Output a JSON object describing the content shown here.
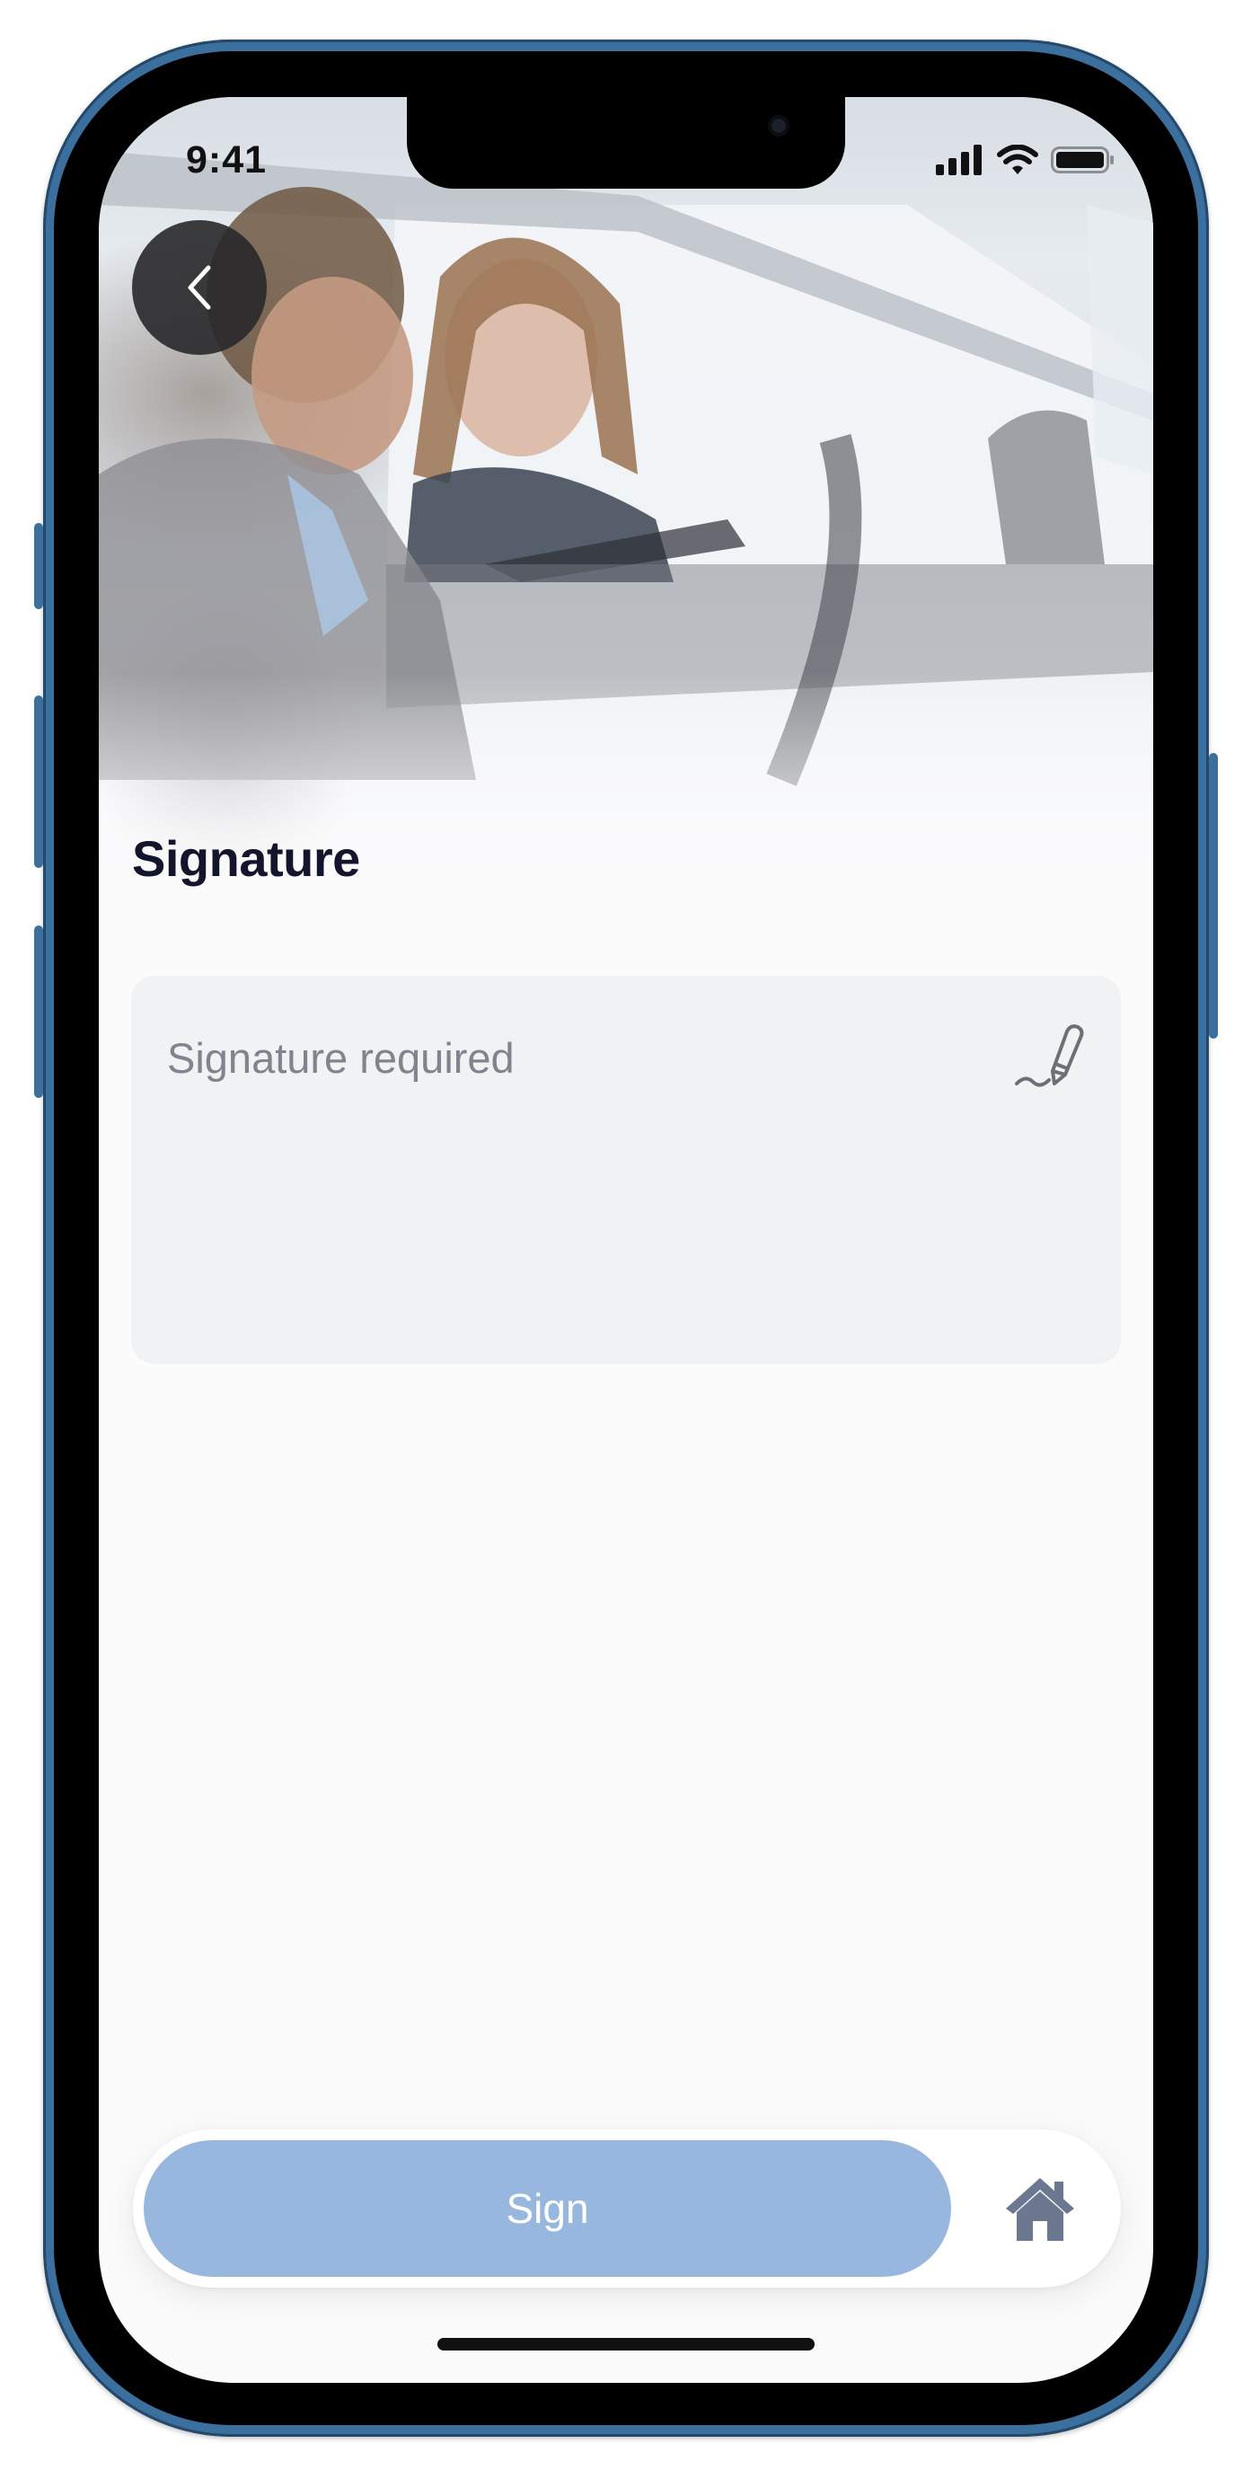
{
  "status_bar": {
    "time": "9:41"
  },
  "header": {
    "back_icon": "chevron-left-icon"
  },
  "page": {
    "title": "Signature"
  },
  "signature_field": {
    "placeholder": "Signature required",
    "icon": "signature-pen-icon"
  },
  "bottom_bar": {
    "sign_label": "Sign",
    "home_icon": "home-icon"
  },
  "colors": {
    "title": "#12152b",
    "field_background": "#f1f2f4",
    "placeholder": "#82838f",
    "sign_button": "#98b7de",
    "home_icon": "#6c7890",
    "device_frame": "#3b6f9e"
  }
}
